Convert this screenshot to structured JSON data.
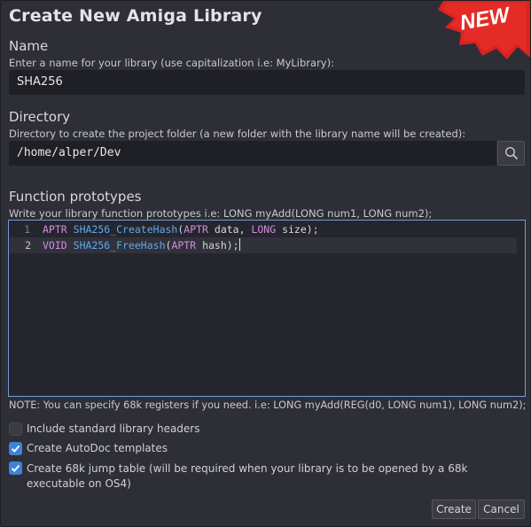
{
  "dialog": {
    "title": "Create New Amiga Library",
    "badge_text": "NEW",
    "badge_color": "#d8231f"
  },
  "name_section": {
    "title": "Name",
    "hint": "Enter a name for your library (use capitalization i.e: MyLibrary):",
    "value": "SHA256"
  },
  "directory_section": {
    "title": "Directory",
    "hint": "Directory to create the project folder (a new folder with the library name will be created):",
    "value": "/home/alper/Dev",
    "browse_icon": "search-icon"
  },
  "prototypes_section": {
    "title": "Function prototypes",
    "hint": "Write your library function prototypes i.e: LONG myAdd(LONG num1, LONG num2);",
    "lines": [
      {
        "num": "1",
        "ret": "APTR",
        "name": "SHA256_CreateHash",
        "open": "(",
        "t1": "APTR",
        "a1": " data, ",
        "t2": "LONG",
        "a2": " size);"
      },
      {
        "num": "2",
        "ret": "VOID",
        "name": "SHA256_FreeHash",
        "open": "(",
        "t1": "APTR",
        "a1": " hash);",
        "t2": "",
        "a2": ""
      }
    ],
    "note": "NOTE: You can specify 68k registers if you need. i.e: LONG myAdd(REG(d0, LONG num1), LONG num2);"
  },
  "options": [
    {
      "label": "Include standard library headers",
      "checked": false
    },
    {
      "label": "Create AutoDoc templates",
      "checked": true
    },
    {
      "label": "Create 68k jump table (will be required when your library is to be opened by a 68k executable on OS4)",
      "checked": true
    }
  ],
  "buttons": {
    "create": "Create",
    "cancel": "Cancel"
  },
  "colors": {
    "keyword": "#d08ee0",
    "function": "#61a9e8",
    "accent": "#3f82d6"
  }
}
